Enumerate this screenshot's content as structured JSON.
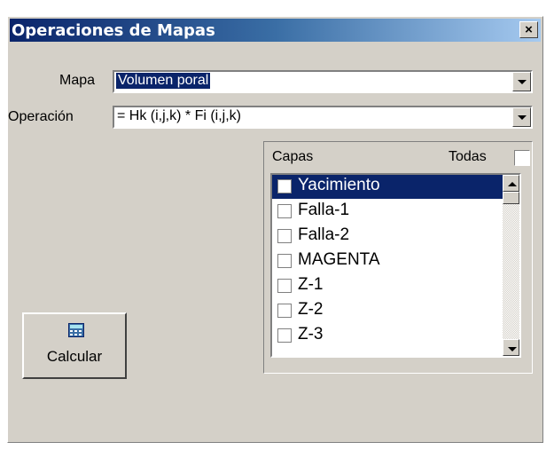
{
  "window": {
    "title": "Operaciones de Mapas",
    "close_label": "×"
  },
  "map": {
    "label": "Mapa",
    "value": "Volumen poral"
  },
  "operation": {
    "label": "Operación",
    "value": "= Hk (i,j,k) * Fi (i,j,k)"
  },
  "layers": {
    "header": "Capas",
    "all_label": "Todas",
    "all_checked": false,
    "items": [
      {
        "label": "Yacimiento",
        "selected": true,
        "checked": false
      },
      {
        "label": "Falla-1",
        "selected": false,
        "checked": false
      },
      {
        "label": "Falla-2",
        "selected": false,
        "checked": false
      },
      {
        "label": "MAGENTA",
        "selected": false,
        "checked": false
      },
      {
        "label": "Z-1",
        "selected": false,
        "checked": false
      },
      {
        "label": "Z-2",
        "selected": false,
        "checked": false
      },
      {
        "label": "Z-3",
        "selected": false,
        "checked": false
      }
    ]
  },
  "calculate_button": {
    "label": "Calcular",
    "icon": "calculator-icon"
  },
  "colors": {
    "title_start": "#0a246a",
    "title_end": "#a6caf0",
    "face": "#d4d0c8",
    "selection": "#0a246a"
  }
}
